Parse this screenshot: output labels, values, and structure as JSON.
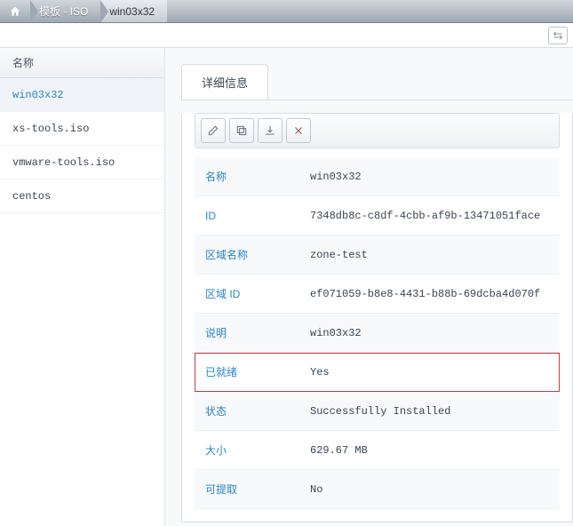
{
  "breadcrumb": {
    "items": [
      "模板 - ISO",
      "win03x32"
    ]
  },
  "sidebar": {
    "header": "名称",
    "items": [
      "win03x32",
      "xs-tools.iso",
      "vmware-tools.iso",
      "centos"
    ],
    "selected_index": 0
  },
  "tabs": {
    "items": [
      "详细信息"
    ]
  },
  "actions": {
    "icons": [
      "edit-icon",
      "copy-icon",
      "download-icon",
      "close-icon"
    ]
  },
  "details": {
    "rows": [
      {
        "label": "名称",
        "value": "win03x32",
        "highlight": false
      },
      {
        "label": "ID",
        "value": "7348db8c-c8df-4cbb-af9b-13471051face",
        "highlight": false
      },
      {
        "label": "区域名称",
        "value": "zone-test",
        "highlight": false
      },
      {
        "label": "区域 ID",
        "value": "ef071059-b8e8-4431-b88b-69dcba4d070f",
        "highlight": false
      },
      {
        "label": "说明",
        "value": "win03x32",
        "highlight": false
      },
      {
        "label": "已就绪",
        "value": "Yes",
        "highlight": true
      },
      {
        "label": "状态",
        "value": "Successfully Installed",
        "highlight": false
      },
      {
        "label": "大小",
        "value": "629.67 MB",
        "highlight": false
      },
      {
        "label": "可提取",
        "value": "No",
        "highlight": false
      }
    ]
  }
}
